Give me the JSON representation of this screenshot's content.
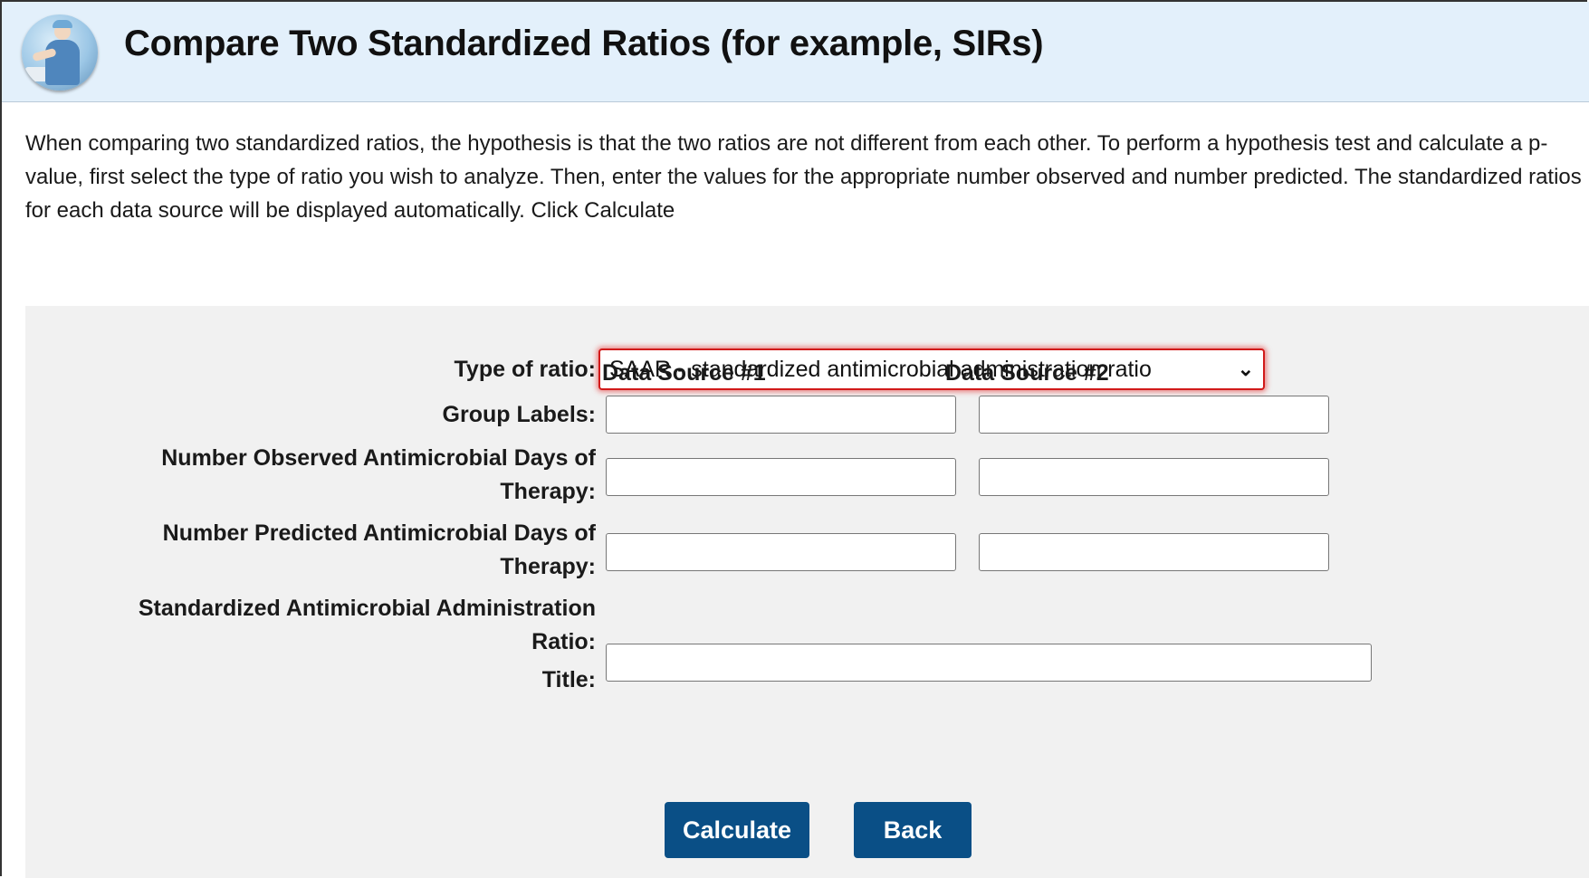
{
  "header": {
    "title": "Compare Two Standardized Ratios (for example, SIRs)",
    "logo_icon": "hand-washing-clinician-icon"
  },
  "intro": {
    "text": "When comparing two standardized ratios, the hypothesis is that the two ratios are not different from each other. To perform a hypothesis test and calculate a p-value, first select the type of ratio you wish to analyze. Then, enter the values for the appropriate number observed and number predicted. The standardized ratios for each data source will be displayed automatically. Click Calculate"
  },
  "form": {
    "type_of_ratio_label": "Type of ratio:",
    "type_of_ratio_value": "SAAR - standardized antimicrobial administration ratio",
    "type_of_ratio_chevron": "chevron-down-icon",
    "col1_header": "Data Source #1",
    "col2_header": "Data Source #2",
    "group_labels_label": "Group Labels:",
    "observed_label_line1": "Number Observed Antimicrobial Days of",
    "observed_label_line2": "Therapy:",
    "predicted_label_line1": "Number Predicted Antimicrobial Days of",
    "predicted_label_line2": "Therapy:",
    "saar_label_line1": "Standardized Antimicrobial Administration",
    "saar_label_line2": "Ratio:",
    "title_label": "Title:",
    "group1_value": "",
    "group2_value": "",
    "observed1_value": "",
    "observed2_value": "",
    "predicted1_value": "",
    "predicted2_value": "",
    "title_value": ""
  },
  "buttons": {
    "calculate": "Calculate",
    "back": "Back"
  },
  "colors": {
    "header_bg": "#e3f0fb",
    "panel_bg": "#f1f1f1",
    "button_bg": "#0a4f86",
    "focus_outline": "#d11a1a"
  }
}
